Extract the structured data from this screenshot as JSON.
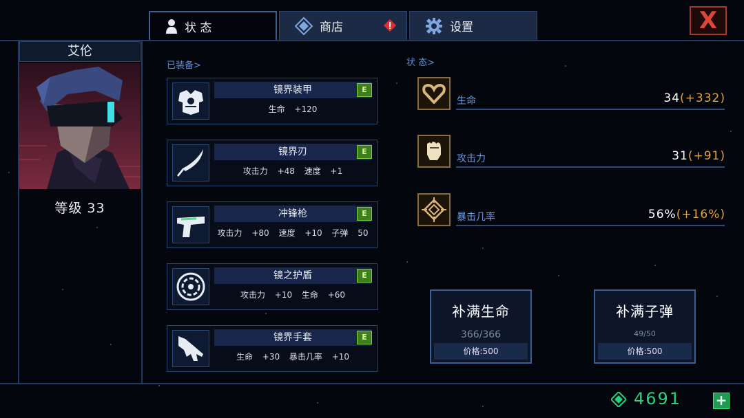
{
  "tabs": [
    {
      "label": "状 态",
      "icon": "person-icon",
      "active": true
    },
    {
      "label": "商店",
      "icon": "diamond-icon",
      "alert": true
    },
    {
      "label": "设置",
      "icon": "gear-icon"
    }
  ],
  "close_label": "X",
  "hero": {
    "name": "艾伦",
    "level_text": "等级 33"
  },
  "equipped_title": "已装备>",
  "equipment": [
    {
      "name": "镜界装甲",
      "grade": "E",
      "stats": "生命 +120",
      "icon": "armor-icon"
    },
    {
      "name": "镜界刃",
      "grade": "E",
      "stats": "攻击力 +48 速度 +1",
      "icon": "blade-icon"
    },
    {
      "name": "冲锋枪",
      "grade": "E",
      "stats": "攻击力 +80 速度 +10 子弹 50",
      "icon": "gun-icon"
    },
    {
      "name": "镜之护盾",
      "grade": "E",
      "stats": "攻击力 +10 生命 +60",
      "icon": "shield-icon"
    },
    {
      "name": "镜界手套",
      "grade": "E",
      "stats": "生命 +30 暴击几率 +10",
      "icon": "glove-icon"
    }
  ],
  "status_title": "状 态>",
  "stats": [
    {
      "label": "生命",
      "value": "34",
      "bonus": "(+332)",
      "icon": "heart-icon"
    },
    {
      "label": "攻击力",
      "value": "31",
      "bonus": "(+91)",
      "icon": "fist-icon"
    },
    {
      "label": "暴击几率",
      "value": "56%",
      "bonus": "(+16%)",
      "icon": "crosshair-icon"
    }
  ],
  "refills": [
    {
      "title": "补满生命",
      "count": "366/366",
      "price": "价格:500"
    },
    {
      "title": "补满子弹",
      "count": "49/50",
      "price": "价格:500"
    }
  ],
  "currency": "4691",
  "add_label": "+",
  "colors": {
    "accent": "#5d8fd6",
    "bonus": "#e4a23b",
    "currency": "#27d17d",
    "grade": "#3f7d1e",
    "close": "#d9483a"
  }
}
